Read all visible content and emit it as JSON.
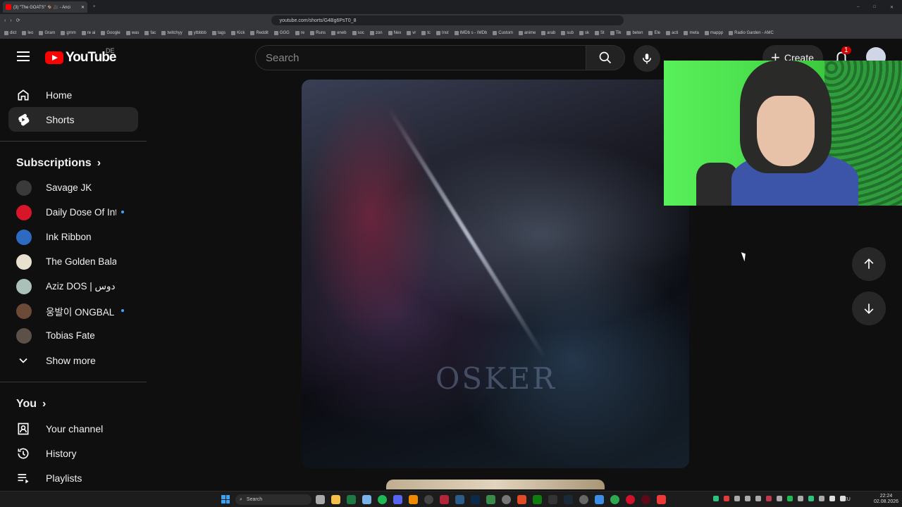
{
  "browser": {
    "tab_title": "(3) \"The GOATS\" 🐐 🎥 - Anci",
    "new_tab": "+",
    "url": "youtube.com/shorts/G4Bg6PsT0_8",
    "bookmarks": [
      "dict",
      "leo",
      "Gram",
      "gmm",
      "re ai",
      "Google",
      "was",
      "fac",
      "twitchyy",
      "ytbbbb",
      "tags",
      "Kick",
      "Reddit",
      "GGG",
      "re",
      "Runs",
      "eneb",
      "soc",
      "zon",
      "Nex",
      "vr",
      "tc",
      "Inst",
      "IMDb s - IMDb",
      "Custom",
      "anime",
      "arab",
      "sub",
      "sk",
      "St",
      "Tik",
      "beten",
      "Ele",
      "acti",
      "meta",
      "mappp",
      "Radio Garden - AMC"
    ]
  },
  "header": {
    "logo_text": "YouTube",
    "country_code": "DE",
    "search_placeholder": "Search",
    "create_label": "Create",
    "notification_count": "1"
  },
  "sidebar": {
    "nav": [
      {
        "label": "Home",
        "icon": "home-icon"
      },
      {
        "label": "Shorts",
        "icon": "shorts-icon",
        "active": true
      }
    ],
    "subscriptions_title": "Subscriptions",
    "subscriptions": [
      {
        "name": "Savage JK",
        "new": false,
        "color": "#3a3a3a"
      },
      {
        "name": "Daily Dose Of Int...",
        "new": true,
        "color": "#d8162a"
      },
      {
        "name": "Ink Ribbon",
        "new": false,
        "color": "#2d6bc2"
      },
      {
        "name": "The Golden Balance",
        "new": false,
        "color": "#e9e1d0"
      },
      {
        "name": "Aziz DOS | عزيز دوس",
        "new": false,
        "color": "#a9c1b8"
      },
      {
        "name": "웅발이 ONGBAL",
        "new": true,
        "color": "#6b4a38"
      },
      {
        "name": "Tobias Fate",
        "new": false,
        "color": "#5b5148"
      }
    ],
    "show_more": "Show more",
    "you_title": "You",
    "you_items": [
      {
        "label": "Your channel",
        "icon": "channel-icon"
      },
      {
        "label": "History",
        "icon": "history-icon"
      },
      {
        "label": "Playlists",
        "icon": "playlists-icon"
      }
    ]
  },
  "video": {
    "watermark": "OSKER"
  },
  "taskbar": {
    "search_label": "Search",
    "language": "DEU",
    "time": "22:24",
    "date": "02.08.2026"
  },
  "colors": {
    "accent": "#ff0000",
    "background": "#0f0f0f",
    "new_dot": "#3ea6ff"
  }
}
